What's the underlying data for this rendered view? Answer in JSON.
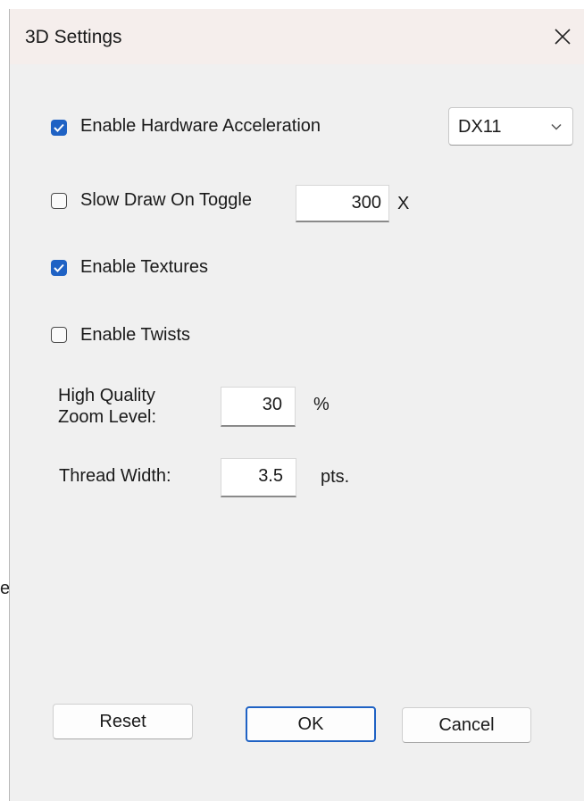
{
  "background": {
    "stub_char": "e"
  },
  "dialog": {
    "title": "3D Settings",
    "close_icon": "close-icon",
    "accent_color": "#1f62c4"
  },
  "options": {
    "hardware_acceleration": {
      "label": "Enable Hardware Acceleration",
      "checked": true
    },
    "renderer_select": {
      "value": "DX11"
    },
    "slow_draw_toggle": {
      "label": "Slow Draw On Toggle",
      "checked": false,
      "value": "300",
      "unit": "X"
    },
    "textures": {
      "label": "Enable Textures",
      "checked": true
    },
    "twists": {
      "label": "Enable Twists",
      "checked": false
    }
  },
  "fields": {
    "zoom_level": {
      "label_line1": "High Quality",
      "label_line2": "Zoom Level:",
      "value": "30",
      "unit": "%"
    },
    "thread_width": {
      "label": "Thread Width:",
      "value": "3.5",
      "unit": "pts."
    }
  },
  "buttons": {
    "reset": "Reset",
    "ok": "OK",
    "cancel": "Cancel"
  }
}
